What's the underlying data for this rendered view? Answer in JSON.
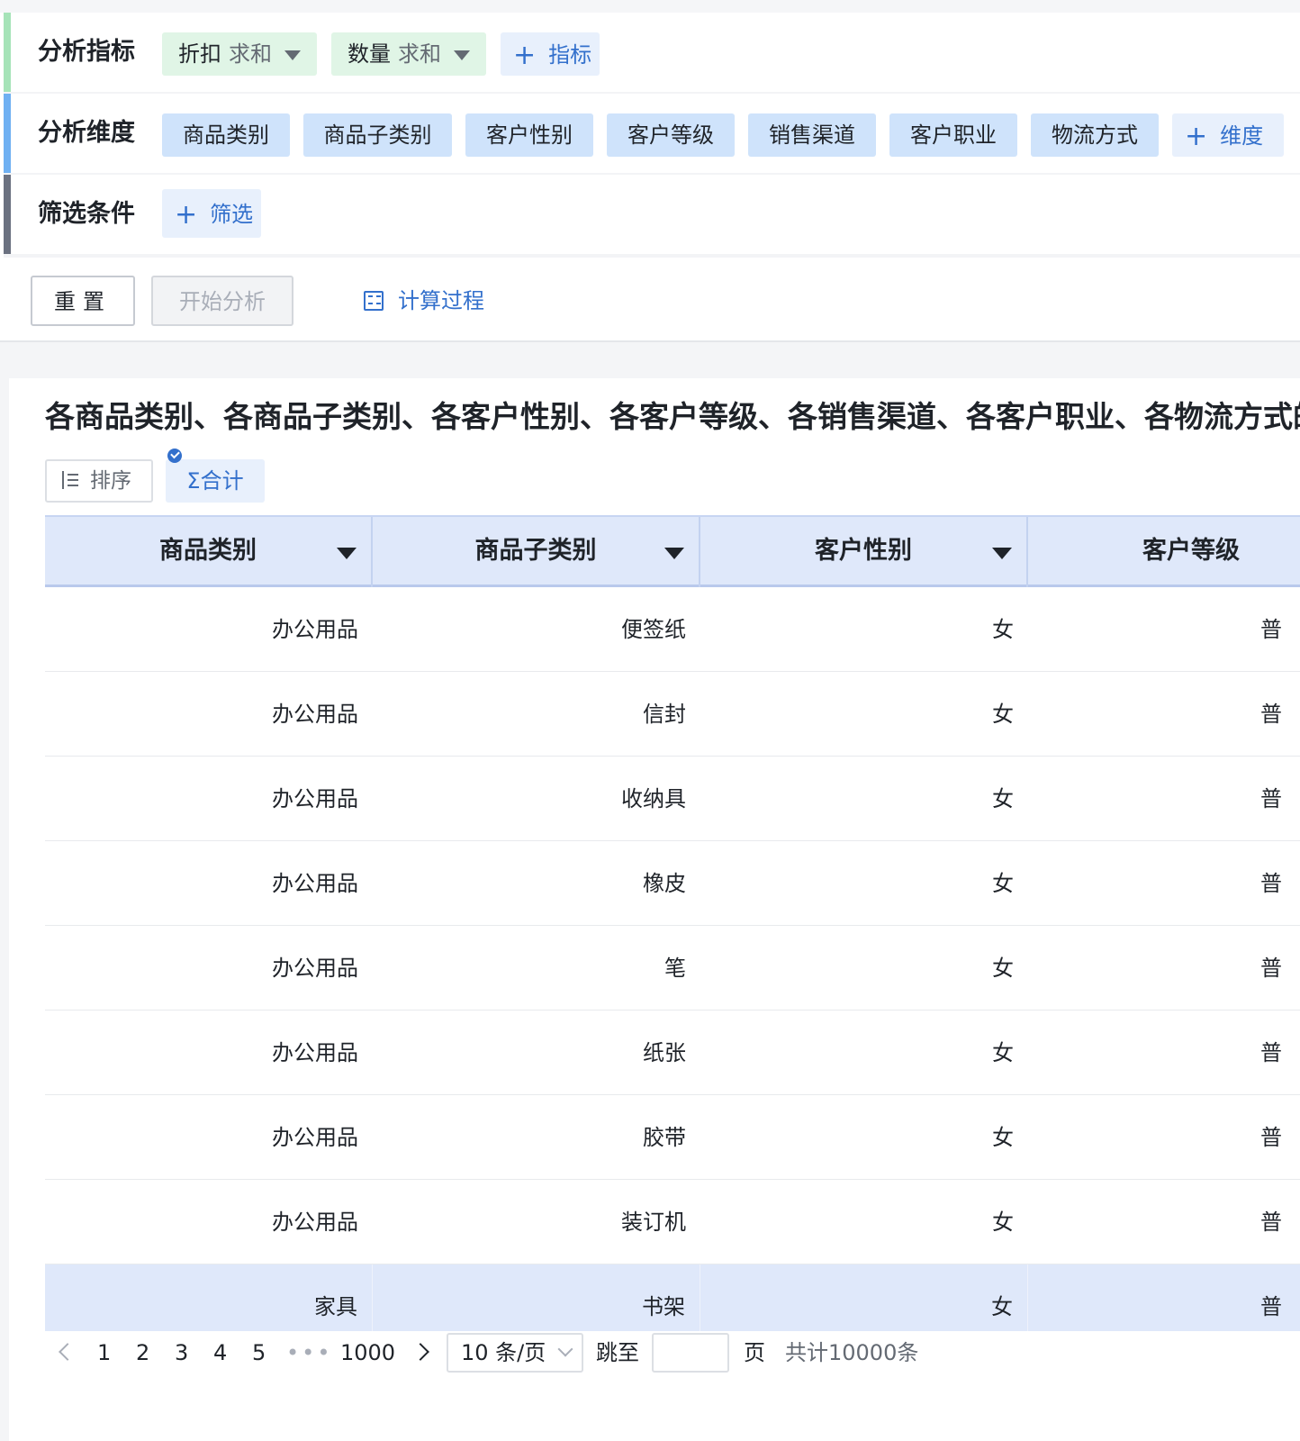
{
  "config": {
    "metrics": {
      "label": "分析指标",
      "accent": "#a6e3b8",
      "items": [
        {
          "name": "折扣",
          "agg": "求和"
        },
        {
          "name": "数量",
          "agg": "求和"
        }
      ],
      "add_label": "指标"
    },
    "dimensions": {
      "label": "分析维度",
      "accent": "#6fb0f2",
      "items": [
        "商品类别",
        "商品子类别",
        "客户性别",
        "客户等级",
        "销售渠道",
        "客户职业",
        "物流方式"
      ],
      "add_label": "维度"
    },
    "filters": {
      "label": "筛选条件",
      "accent": "#6b7180",
      "add_label": "筛选"
    },
    "actions": {
      "reset_label": "重置",
      "start_label": "开始分析",
      "calc_label": "计算过程"
    }
  },
  "result": {
    "title": "各商品类别、各商品子类别、各客户性别、各客户等级、各销售渠道、各客户职业、各物流方式的折扣",
    "toolbar": {
      "sort_label": "排序",
      "total_label": "Σ合计"
    },
    "columns": [
      "商品类别",
      "商品子类别",
      "客户性别",
      "客户等级"
    ],
    "rows": [
      [
        "办公用品",
        "便签纸",
        "女",
        "普"
      ],
      [
        "办公用品",
        "信封",
        "女",
        "普"
      ],
      [
        "办公用品",
        "收纳具",
        "女",
        "普"
      ],
      [
        "办公用品",
        "橡皮",
        "女",
        "普"
      ],
      [
        "办公用品",
        "笔",
        "女",
        "普"
      ],
      [
        "办公用品",
        "纸张",
        "女",
        "普"
      ],
      [
        "办公用品",
        "胶带",
        "女",
        "普"
      ],
      [
        "办公用品",
        "装订机",
        "女",
        "普"
      ],
      [
        "家具",
        "书架",
        "女",
        "普"
      ]
    ],
    "highlighted_row": 8
  },
  "pagination": {
    "pages": [
      "1",
      "2",
      "3",
      "4",
      "5"
    ],
    "ellipsis": "•••",
    "last_page": "1000",
    "page_size": "10 条/页",
    "jump_label": "跳至",
    "page_suffix": "页",
    "total_text": "共计10000条",
    "jump_value": ""
  }
}
